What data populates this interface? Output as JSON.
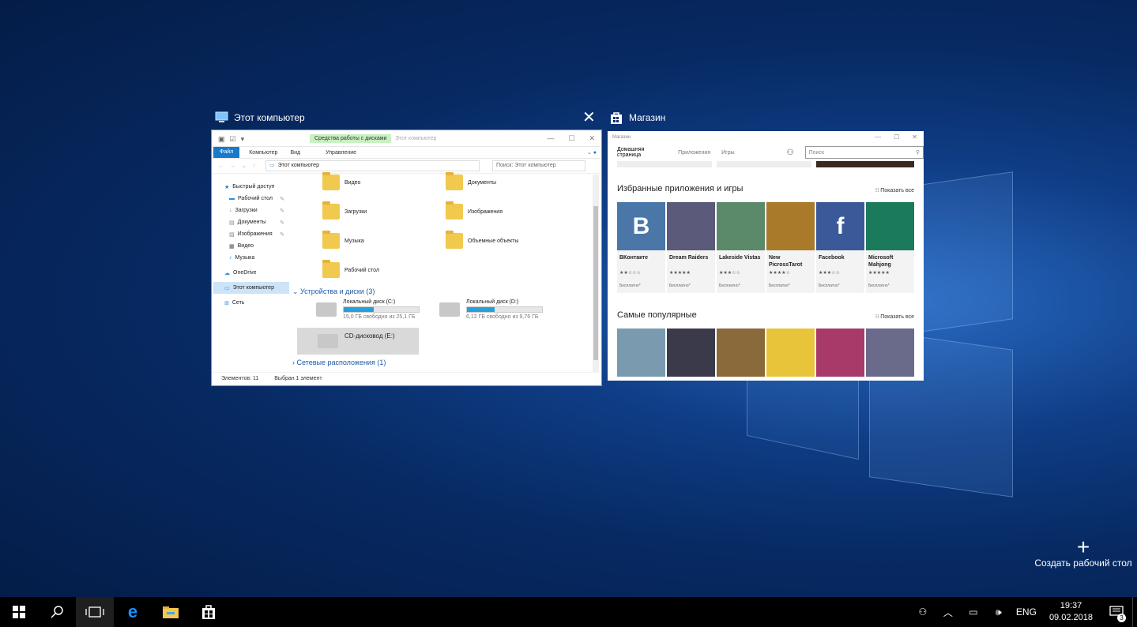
{
  "explorer": {
    "thumb_title": "Этот компьютер",
    "context_tab": "Средства работы с дисками",
    "context_tab2": "Этот компьютер",
    "ribbon": {
      "file": "Файл",
      "computer": "Компьютер",
      "view": "Вид",
      "manage": "Управление"
    },
    "address": "Этот компьютер",
    "search_placeholder": "Поиск: Этот компьютер",
    "nav": [
      {
        "label": "Быстрый доступ"
      },
      {
        "label": "Рабочий стол"
      },
      {
        "label": "Загрузки"
      },
      {
        "label": "Документы"
      },
      {
        "label": "Изображения"
      },
      {
        "label": "Видео"
      },
      {
        "label": "Музыка"
      },
      {
        "label": "OneDrive"
      },
      {
        "label": "Этот компьютер"
      },
      {
        "label": "Сеть"
      }
    ],
    "folders": [
      "Видео",
      "Документы",
      "Загрузки",
      "Изображения",
      "Музыка",
      "Объемные объекты",
      "Рабочий стол"
    ],
    "section_devices": "Устройства и диски (3)",
    "drives": [
      {
        "name": "Локальный диск (C:)",
        "free": "15,0 ГБ свободно из 25,1 ГБ",
        "used_fraction": 0.4
      },
      {
        "name": "Локальный диск (D:)",
        "free": "6,12 ГБ свободно из 9,76 ГБ",
        "used_fraction": 0.37
      },
      {
        "name": "CD-дисковод (E:)"
      }
    ],
    "section_network": "Сетевые расположения (1)",
    "status_items": "Элементов: 11",
    "status_selected": "Выбран 1 элемент"
  },
  "store": {
    "thumb_title": "Магазин",
    "window_title": "Магазин",
    "nav": {
      "home": "Домашняя страница",
      "apps": "Приложения",
      "games": "Игры"
    },
    "search_placeholder": "Поиск",
    "featured_heading": "Избранные приложения и игры",
    "show_all": "Показать все",
    "featured": [
      {
        "name": "ВКонтакте",
        "stars": "★★☆☆☆",
        "price": "Бесплатно*",
        "color": "#4a76a8",
        "glyph": "B"
      },
      {
        "name": "Dream Raiders",
        "stars": "★★★★★",
        "price": "Бесплатно*",
        "color": "#5b5a7a",
        "glyph": ""
      },
      {
        "name": "Lakeside Vistas",
        "stars": "★★★☆☆",
        "price": "Бесплатно*",
        "color": "#5a8a6a",
        "glyph": ""
      },
      {
        "name": "New PicrossTarot",
        "stars": "★★★★☆",
        "price": "Бесплатно*",
        "color": "#a87a2a",
        "glyph": ""
      },
      {
        "name": "Facebook",
        "stars": "★★★☆☆",
        "price": "Бесплатно*",
        "color": "#3b5998",
        "glyph": "f"
      },
      {
        "name": "Microsoft Mahjong",
        "stars": "★★★★★",
        "price": "Бесплатно*",
        "color": "#1c7a5c",
        "glyph": ""
      }
    ],
    "popular_heading": "Самые популярные",
    "popular_colors": [
      "#7a9ab0",
      "#3a3a4a",
      "#8a6a3a",
      "#e8c43a",
      "#a83a6a",
      "#6a6a8a"
    ]
  },
  "new_desktop": "Создать рабочий стол",
  "taskbar": {
    "lang": "ENG",
    "time": "19:37",
    "date": "09.02.2018",
    "notifications": "3"
  }
}
